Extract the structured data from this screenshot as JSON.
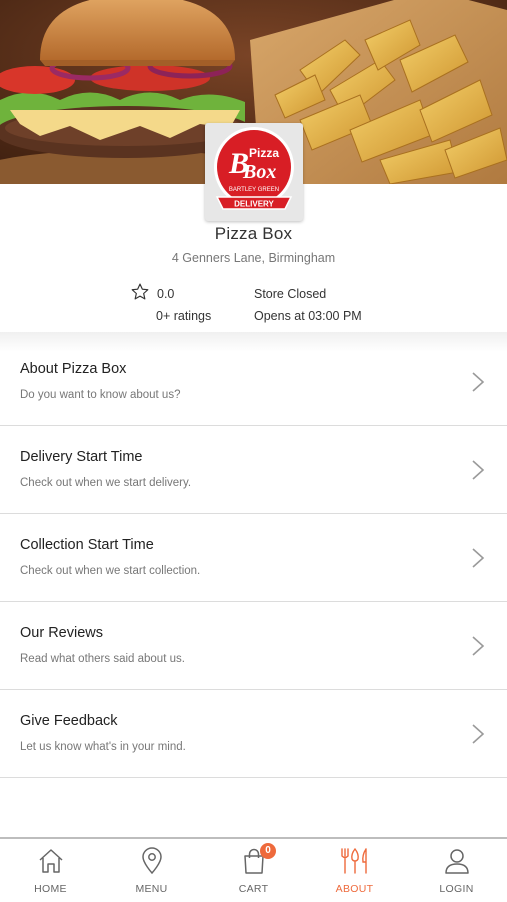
{
  "store": {
    "name": "Pizza Box",
    "address": "4 Genners Lane, Birmingham",
    "rating": "0.0",
    "ratings_count": "0+ ratings",
    "status": "Store Closed",
    "opens": "Opens at 03:00 PM",
    "logo_text_top": "Pizza",
    "logo_text_main": "Box",
    "logo_text_small": "BARTLEY GREEN",
    "logo_text_ribbon": "DELIVERY"
  },
  "menu": [
    {
      "title": "About Pizza Box",
      "subtitle": "Do you want to know about us?"
    },
    {
      "title": "Delivery Start Time",
      "subtitle": "Check out when we start delivery."
    },
    {
      "title": "Collection Start Time",
      "subtitle": "Check out when we start collection."
    },
    {
      "title": "Our Reviews",
      "subtitle": "Read what others said about us."
    },
    {
      "title": "Give Feedback",
      "subtitle": "Let us know what's in your mind."
    }
  ],
  "tabbar": {
    "tabs": [
      {
        "label": "HOME",
        "icon": "home-icon"
      },
      {
        "label": "MENU",
        "icon": "location-pin-icon"
      },
      {
        "label": "CART",
        "icon": "shopping-bag-icon"
      },
      {
        "label": "ABOUT",
        "icon": "fork-knife-icon"
      },
      {
        "label": "LOGIN",
        "icon": "user-icon"
      }
    ],
    "cart_count": "0",
    "active": "ABOUT"
  },
  "colors": {
    "accent": "#ee6a3c",
    "logo_red": "#d81e25"
  }
}
